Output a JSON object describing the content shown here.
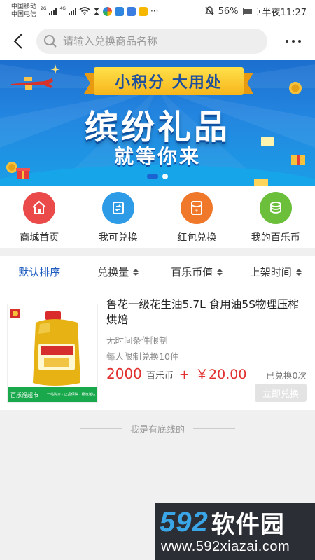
{
  "status_bar": {
    "carrier_1": "中国移动",
    "carrier_2": "中国电信",
    "net_1": "2G",
    "net_2": "4G",
    "battery": "56%",
    "time": "半夜11:27"
  },
  "header": {
    "search_placeholder": "请输入兑换商品名称"
  },
  "banner": {
    "ribbon": "小积分 大用处",
    "title": "缤纷礼品",
    "subtitle": "就等你来",
    "page_count": 2,
    "active_page": 1
  },
  "nav": [
    {
      "label": "商城首页",
      "icon": "home-icon",
      "color": "#ea4a4a"
    },
    {
      "label": "我可兑换",
      "icon": "exchange-icon",
      "color": "#2e9be6"
    },
    {
      "label": "红包兑换",
      "icon": "red-packet-icon",
      "color": "#f0782b"
    },
    {
      "label": "我的百乐币",
      "icon": "coins-icon",
      "color": "#6bbf3b"
    }
  ],
  "sort": {
    "items": [
      {
        "label": "默认排序",
        "active": true
      },
      {
        "label": "兑换量",
        "active": false
      },
      {
        "label": "百乐币值",
        "active": false
      },
      {
        "label": "上架时间",
        "active": false
      }
    ]
  },
  "product": {
    "title": "鲁花一级花生油5.7L 食用油5S物理压榨烘焙",
    "line1": "无时间条件限制",
    "line2": "每人限制兑换10件",
    "points": "2000",
    "unit": "百乐币",
    "plus": "+",
    "cash": "￥20.00",
    "sold": "已兑换0次",
    "button": "立即兑换",
    "img_banner": "百乐福超市",
    "img_tagline": "一站购齐 · 正品保障 · 极速送达"
  },
  "end_note": "我是有底线的",
  "watermark": {
    "num": "592",
    "cn": "软件园",
    "url": "www.592xiazai.com"
  },
  "colors": {
    "accent_blue": "#1d5bbf",
    "price_red": "#e0312e"
  }
}
